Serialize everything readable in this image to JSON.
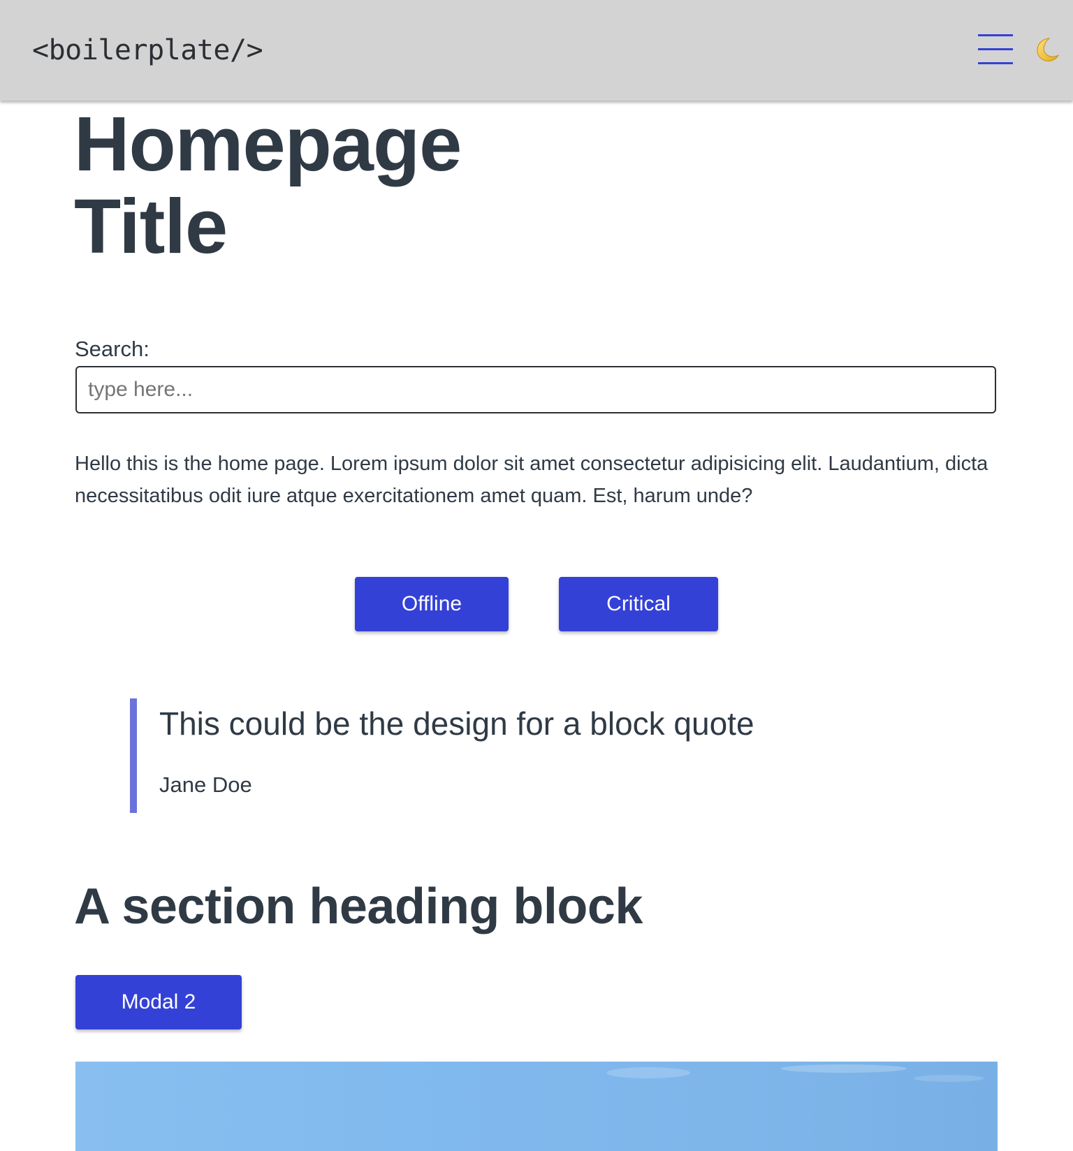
{
  "header": {
    "brand": "<boilerplate/>",
    "menu_icon": "hamburger-icon",
    "theme_icon": "moon-icon"
  },
  "main": {
    "title": "Homepage Title",
    "search": {
      "label": "Search:",
      "placeholder": "type here...",
      "value": ""
    },
    "intro": "Hello this is the home page. Lorem ipsum dolor sit amet consectetur adipisicing elit. Laudantium, dicta necessitatibus odit iure atque exercitationem amet quam. Est, harum unde?",
    "buttons": {
      "offline": "Offline",
      "critical": "Critical"
    },
    "quote": {
      "text": "This could be the design for a block quote",
      "author": "Jane Doe"
    },
    "section": {
      "heading": "A section heading block",
      "modal_button": "Modal 2"
    }
  },
  "colors": {
    "header_bg": "#d3d3d3",
    "accent": "#3441d6",
    "quote_border": "#6b72dc",
    "text": "#2f3a45",
    "sky": "#82baee"
  }
}
